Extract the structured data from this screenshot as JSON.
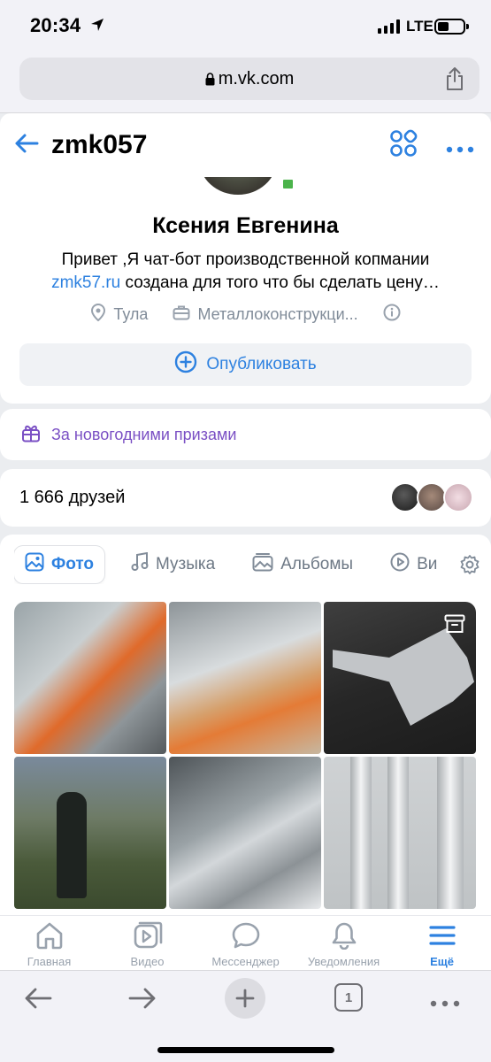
{
  "status_bar": {
    "time": "20:34",
    "network": "LTE",
    "icons": [
      "location-arrow-icon",
      "signal-icon",
      "battery-icon"
    ]
  },
  "browser": {
    "url": "m.vk.com",
    "icons": [
      "lock-icon",
      "share-icon"
    ]
  },
  "header": {
    "title": "zmk057",
    "icons": [
      "back-arrow-icon",
      "apps-grid-icon",
      "more-dots-icon"
    ]
  },
  "profile": {
    "name": "Ксения Евгенина",
    "bio_line1": "Привет ,Я чат-бот производственной копмании",
    "bio_link": "zmk57.ru",
    "bio_line2_rest": " создана для того что бы сделать цену…",
    "city": "Тула",
    "work": "Металлоконструкци...",
    "publish_label": "Опубликовать"
  },
  "gift_banner": {
    "label": "За новогодними призами"
  },
  "friends": {
    "label": "1 666 друзей"
  },
  "media": {
    "tabs": [
      {
        "label": "Фото",
        "icon": "photo-icon",
        "active": true
      },
      {
        "label": "Музыка",
        "icon": "music-icon",
        "active": false
      },
      {
        "label": "Альбомы",
        "icon": "album-icon",
        "active": false
      },
      {
        "label": "Ви",
        "icon": "video-play-icon",
        "active": false
      }
    ]
  },
  "bottom_nav": [
    {
      "label": "Главная",
      "icon": "home-icon",
      "active": false
    },
    {
      "label": "Видео",
      "icon": "video-icon",
      "active": false
    },
    {
      "label": "Мессенджер",
      "icon": "messenger-icon",
      "active": false
    },
    {
      "label": "Уведомления",
      "icon": "bell-icon",
      "active": false
    },
    {
      "label": "Ещё",
      "icon": "menu-icon",
      "active": true
    }
  ],
  "browser_toolbar": {
    "tab_count": "1"
  },
  "colors": {
    "accent": "#2d81e0",
    "gift": "#7a4fc4",
    "online": "#4bb34b",
    "muted": "#818c99"
  }
}
